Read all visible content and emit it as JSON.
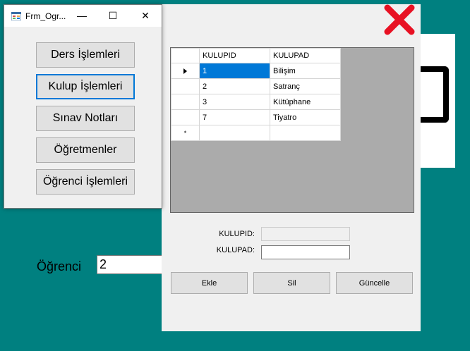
{
  "menu_window": {
    "title": "Frm_Ogr...",
    "minimize_glyph": "—",
    "maximize_glyph": "☐",
    "close_glyph": "✕",
    "buttons": [
      {
        "label": "Ders İşlemleri"
      },
      {
        "label": "Kulup İşlemleri"
      },
      {
        "label": "Sınav Notları"
      },
      {
        "label": "Öğretmenler"
      },
      {
        "label": "Öğrenci İşlemleri"
      }
    ]
  },
  "student": {
    "label": "Öğrenci",
    "value": "2"
  },
  "club_form": {
    "close_icon": "red-x-icon",
    "grid": {
      "columns": [
        "KULUPID",
        "KULUPAD"
      ],
      "rows": [
        {
          "id": "1",
          "name": "Bilişim",
          "selected": true
        },
        {
          "id": "2",
          "name": "Satranç"
        },
        {
          "id": "3",
          "name": "Kütüphane"
        },
        {
          "id": "7",
          "name": "Tiyatro"
        }
      ],
      "new_row_marker": "*"
    },
    "fields": {
      "kulupid_label": "KULUPID:",
      "kulupid_value": "",
      "kulupad_label": "KULUPAD:",
      "kulupad_value": ""
    },
    "buttons": {
      "add": "Ekle",
      "delete": "Sil",
      "update": "Güncelle"
    }
  },
  "colors": {
    "desktop": "#008080",
    "selection": "#0078d7",
    "close_x": "#e81123"
  }
}
